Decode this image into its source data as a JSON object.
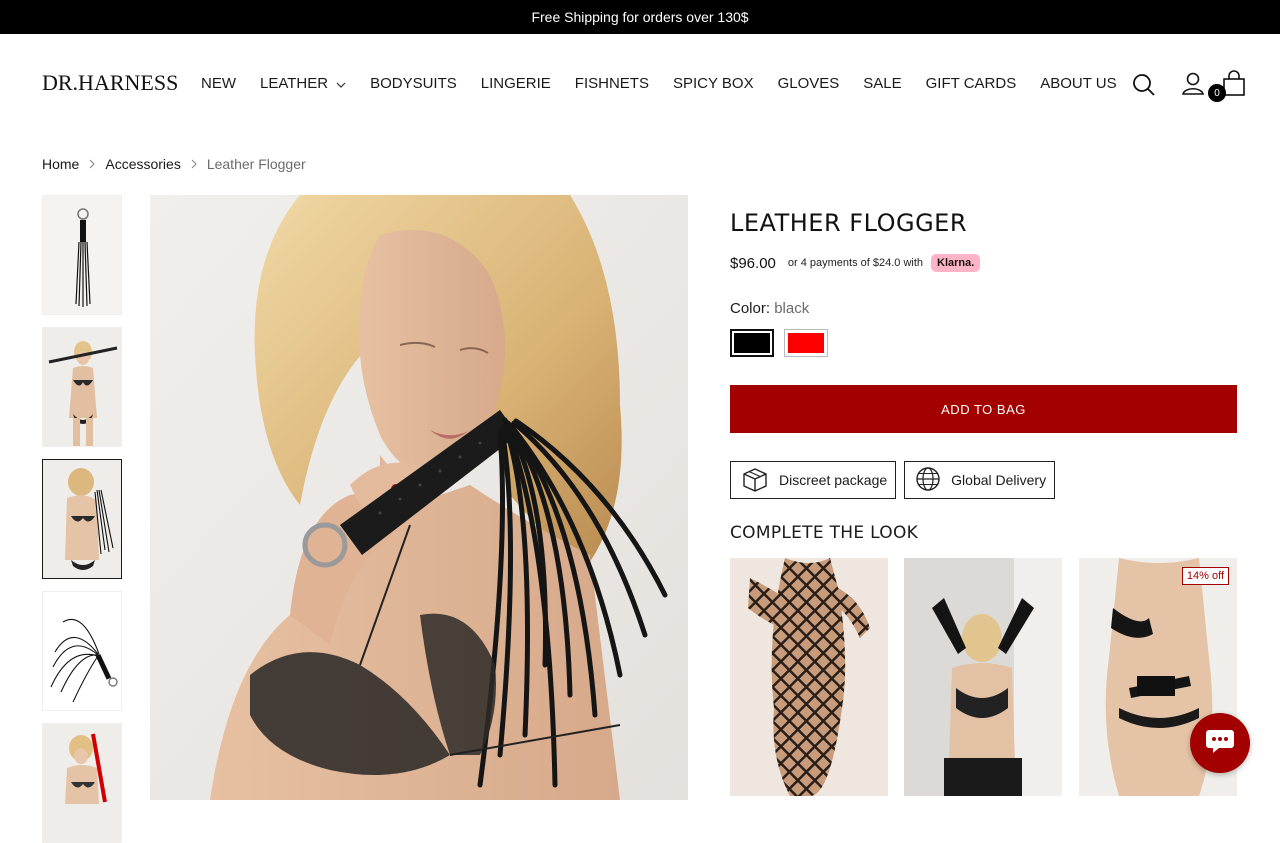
{
  "announcement": "Free Shipping for orders over 130$",
  "brand": "DR.HARNESS",
  "nav": {
    "items": [
      {
        "label": "NEW"
      },
      {
        "label": "LEATHER",
        "has_dropdown": true
      },
      {
        "label": "BODYSUITS"
      },
      {
        "label": "LINGERIE"
      },
      {
        "label": "FISHNETS"
      },
      {
        "label": "SPICY BOX"
      },
      {
        "label": "GLOVES"
      },
      {
        "label": "SALE"
      },
      {
        "label": "GIFT CARDS"
      },
      {
        "label": "ABOUT US"
      }
    ]
  },
  "header": {
    "icons": [
      "search-icon",
      "account-icon",
      "bag-icon"
    ],
    "cart_count": "0"
  },
  "breadcrumb": {
    "home": "Home",
    "category": "Accessories",
    "current": "Leather Flogger"
  },
  "gallery": {
    "thumbnails": [
      "flogger-product",
      "model-holding-flogger",
      "model-flogger-over-shoulder",
      "flogger-coiled",
      "model-red-flogger"
    ],
    "active_index": 2
  },
  "product": {
    "title": "LEATHER FLOGGER",
    "price": "$96.00",
    "installments": "or 4 payments of $24.0 with",
    "klarna_label": "Klarna.",
    "color_label": "Color:",
    "color_value": "black",
    "swatches": [
      {
        "name": "black",
        "hex": "#000000",
        "selected": true
      },
      {
        "name": "red",
        "hex": "#ff0000",
        "selected": false
      }
    ],
    "add_to_bag": "ADD TO BAG",
    "perks": [
      {
        "icon": "package-icon",
        "label": "Discreet package"
      },
      {
        "icon": "globe-icon",
        "label": "Global Delivery"
      }
    ]
  },
  "complete_the_look": {
    "title": "COMPLETE THE LOOK",
    "items": [
      {
        "image": "fishnet-bodysuit"
      },
      {
        "image": "black-gloves-bra"
      },
      {
        "image": "harness-lingerie",
        "badge": "14% off"
      }
    ]
  },
  "colors": {
    "accent": "#a30000",
    "announce_bg": "#000000",
    "klarna": "#ffb3c7"
  }
}
